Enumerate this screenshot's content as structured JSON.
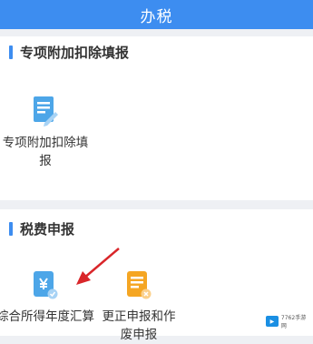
{
  "header": {
    "title": "办税"
  },
  "special_deduction": {
    "title": "专项附加扣除填报",
    "tiles": [
      {
        "label": "专项附加扣除填报",
        "icon": "document-edit-icon"
      }
    ]
  },
  "tax_declaration": {
    "title": "税费申报",
    "tiles": [
      {
        "label": "综合所得年度汇算",
        "icon": "annual-settlement-icon"
      },
      {
        "label": "更正申报和作废申报",
        "icon": "correction-declaration-icon"
      }
    ]
  },
  "watermark": {
    "text": "7762手游网"
  },
  "colors": {
    "brand": "#3d8df0",
    "accent_orange": "#f5a623",
    "arrow": "#d9262a"
  }
}
